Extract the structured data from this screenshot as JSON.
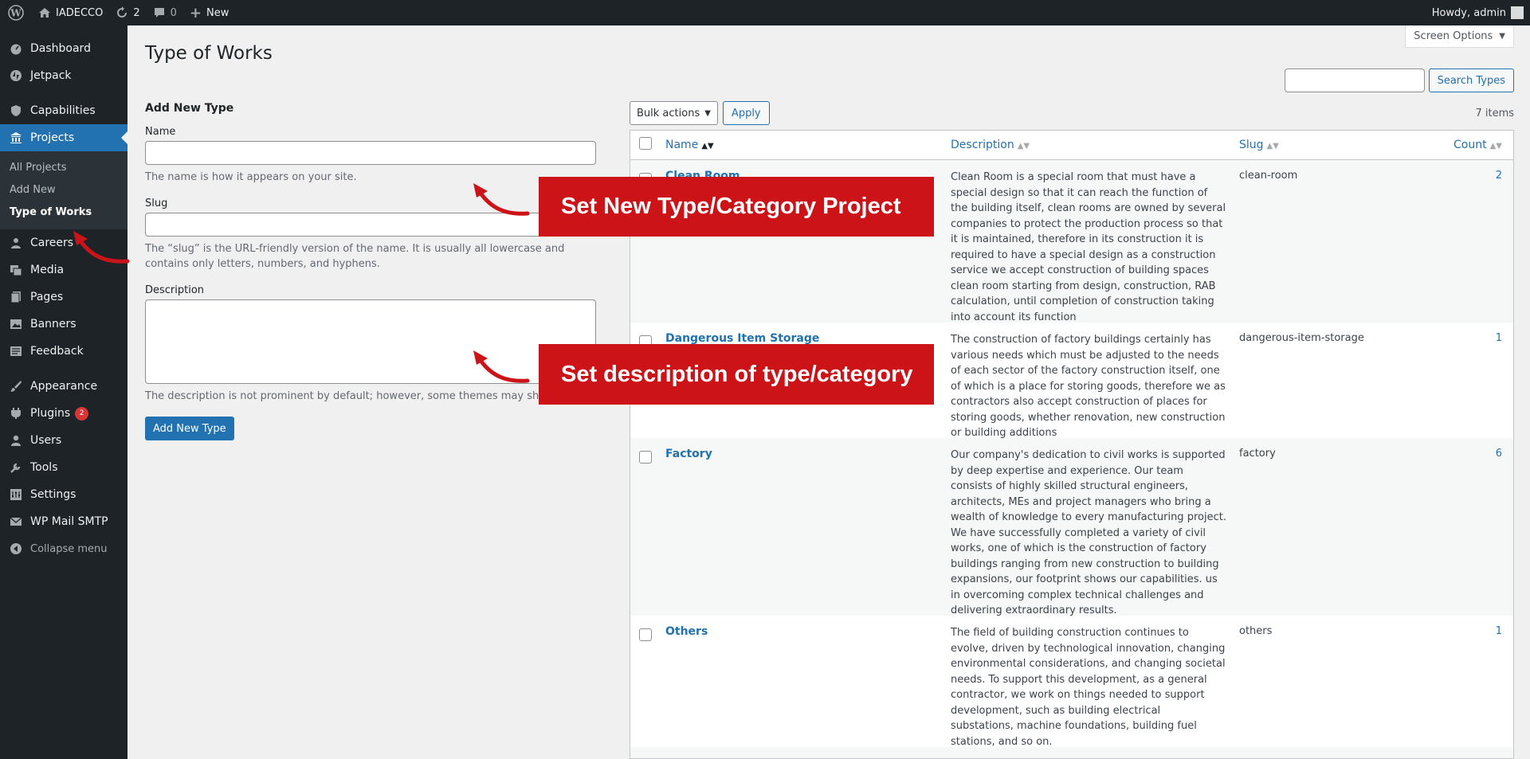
{
  "adminbar": {
    "site_name": "IADECCO",
    "updates_count": "2",
    "comments_count": "0",
    "new_label": "New",
    "greeting": "Howdy, admin"
  },
  "sidebar": {
    "items": [
      {
        "label": "Dashboard",
        "icon": "dashboard-icon"
      },
      {
        "label": "Jetpack",
        "icon": "jetpack-icon"
      },
      {
        "label": "Capabilities",
        "icon": "capabilities-icon"
      },
      {
        "label": "Projects",
        "icon": "projects-icon"
      },
      {
        "label": "Careers",
        "icon": "careers-icon"
      },
      {
        "label": "Media",
        "icon": "media-icon"
      },
      {
        "label": "Pages",
        "icon": "pages-icon"
      },
      {
        "label": "Banners",
        "icon": "banners-icon"
      },
      {
        "label": "Feedback",
        "icon": "feedback-icon"
      },
      {
        "label": "Appearance",
        "icon": "appearance-icon"
      },
      {
        "label": "Plugins",
        "icon": "plugins-icon",
        "badge": "2"
      },
      {
        "label": "Users",
        "icon": "users-icon"
      },
      {
        "label": "Tools",
        "icon": "tools-icon"
      },
      {
        "label": "Settings",
        "icon": "settings-icon"
      },
      {
        "label": "WP Mail SMTP",
        "icon": "mail-icon"
      }
    ],
    "submenu": [
      "All Projects",
      "Add New",
      "Type of Works"
    ],
    "collapse_label": "Collapse menu"
  },
  "page": {
    "title": "Type of Works",
    "screen_options": "Screen Options",
    "search_button": "Search Types",
    "search_value": ""
  },
  "form": {
    "heading": "Add New Type",
    "name_label": "Name",
    "name_hint": "The name is how it appears on your site.",
    "slug_label": "Slug",
    "slug_hint": "The “slug” is the URL-friendly version of the name. It is usually all lowercase and contains only letters, numbers, and hyphens.",
    "description_label": "Description",
    "description_hint": "The description is not prominent by default; however, some themes may show it.",
    "submit_label": "Add New Type"
  },
  "table": {
    "bulk_actions": "Bulk actions",
    "apply": "Apply",
    "items_count": "7 items",
    "columns": {
      "name": "Name",
      "description": "Description",
      "slug": "Slug",
      "count": "Count"
    },
    "rows": [
      {
        "name": "Clean Room",
        "description": "Clean Room is a special room that must have a special design so that it can reach the function of the building itself, clean rooms are owned by several companies to protect the production process so that it is maintained, therefore in its construction it is required to have a special design as a construction service we accept construction of building spaces clean room starting from design, construction, RAB calculation, until completion of construction taking into account its function",
        "slug": "clean-room",
        "count": "2"
      },
      {
        "name": "Dangerous Item Storage",
        "description": "The construction of factory buildings certainly has various needs which must be adjusted to the needs of each sector of the factory construction itself, one of which is a place for storing goods, therefore we as contractors also accept construction of places for storing goods, whether renovation, new construction or building additions",
        "slug": "dangerous-item-storage",
        "count": "1"
      },
      {
        "name": "Factory",
        "description": "Our company's dedication to civil works is supported by deep expertise and experience. Our team consists of highly skilled structural engineers, architects, MEs and project managers who bring a wealth of knowledge to every manufacturing project. We have successfully completed a variety of civil works, one of which is the construction of factory buildings ranging from new construction to building expansions, our footprint shows our capabilities. us in overcoming complex technical challenges and delivering extraordinary results.",
        "slug": "factory",
        "count": "6"
      },
      {
        "name": "Others",
        "description": "The field of building construction continues to evolve, driven by technological innovation, changing environmental considerations, and changing societal needs. To support this development, as a general contractor, we work on things needed to support development, such as building electrical substations, machine foundations, building fuel stations, and so on.",
        "slug": "others",
        "count": "1"
      }
    ]
  },
  "callouts": {
    "top": "Set New Type/Category Project",
    "bottom": "Set description of type/category"
  },
  "colors": {
    "callout_red": "#cc1318",
    "accent_blue": "#2271b1",
    "sidebar_bg": "#1d2327"
  }
}
